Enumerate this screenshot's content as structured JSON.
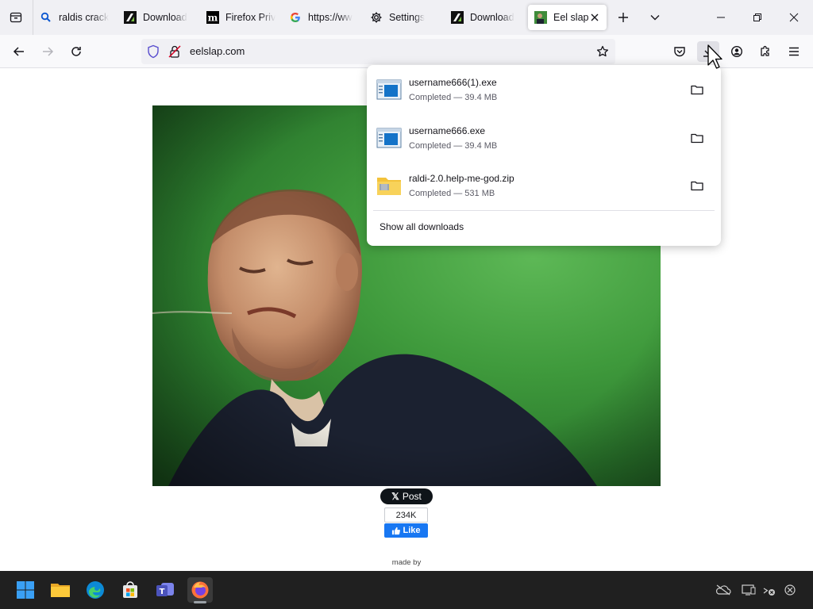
{
  "browser": {
    "tabs": [
      {
        "title": "raldis crack",
        "icon": "search-icon",
        "active": false
      },
      {
        "title": "Download",
        "icon": "download-site-icon",
        "active": false
      },
      {
        "title": "Firefox Priv",
        "icon": "m-logo-icon",
        "active": false
      },
      {
        "title": "https://ww",
        "icon": "google-icon",
        "active": false
      },
      {
        "title": "Settings",
        "icon": "gear-icon",
        "active": false
      },
      {
        "title": "Download",
        "icon": "download-site-icon",
        "active": false
      },
      {
        "title": "Eel slap!",
        "icon": "eel-slap-favicon",
        "active": true
      }
    ],
    "url": "eelslap.com"
  },
  "downloads": {
    "items": [
      {
        "name": "username666(1).exe",
        "status": "Completed — 39.4 MB",
        "icon": "exe-file-icon"
      },
      {
        "name": "username666.exe",
        "status": "Completed — 39.4 MB",
        "icon": "exe-file-icon"
      },
      {
        "name": "raldi-2.0.help-me-god.zip",
        "status": "Completed — 531 MB",
        "icon": "zip-file-icon"
      }
    ],
    "show_all": "Show all downloads"
  },
  "page": {
    "post_label": "Post",
    "like_count": "234K",
    "like_label": "Like",
    "made_by": "made by"
  },
  "colors": {
    "accent": "#0061e0",
    "facebook": "#1877f2",
    "taskbar": "#202020"
  }
}
